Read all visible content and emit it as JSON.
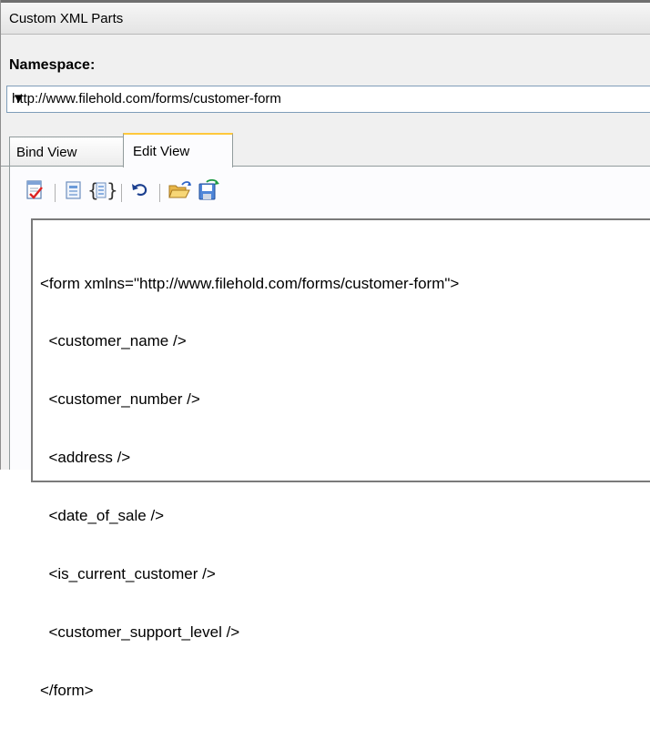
{
  "panel": {
    "title": "Custom XML Parts"
  },
  "namespace": {
    "label": "Namespace:",
    "selected": "http://www.filehold.com/forms/customer-form"
  },
  "tabs": [
    {
      "label": "Bind View",
      "active": false
    },
    {
      "label": "Edit View",
      "active": true
    }
  ],
  "toolbar": {
    "icons": [
      "validate-icon",
      "properties-icon",
      "format-xml-icon",
      "undo-icon",
      "open-folder-icon",
      "save-icon"
    ]
  },
  "editor": {
    "lines": [
      "<form xmlns=\"http://www.filehold.com/forms/customer-form\">",
      "  <customer_name />",
      "  <customer_number />",
      "  <address />",
      "  <date_of_sale />",
      "  <is_current_customer />",
      "  <customer_support_level />",
      "</form>"
    ]
  }
}
